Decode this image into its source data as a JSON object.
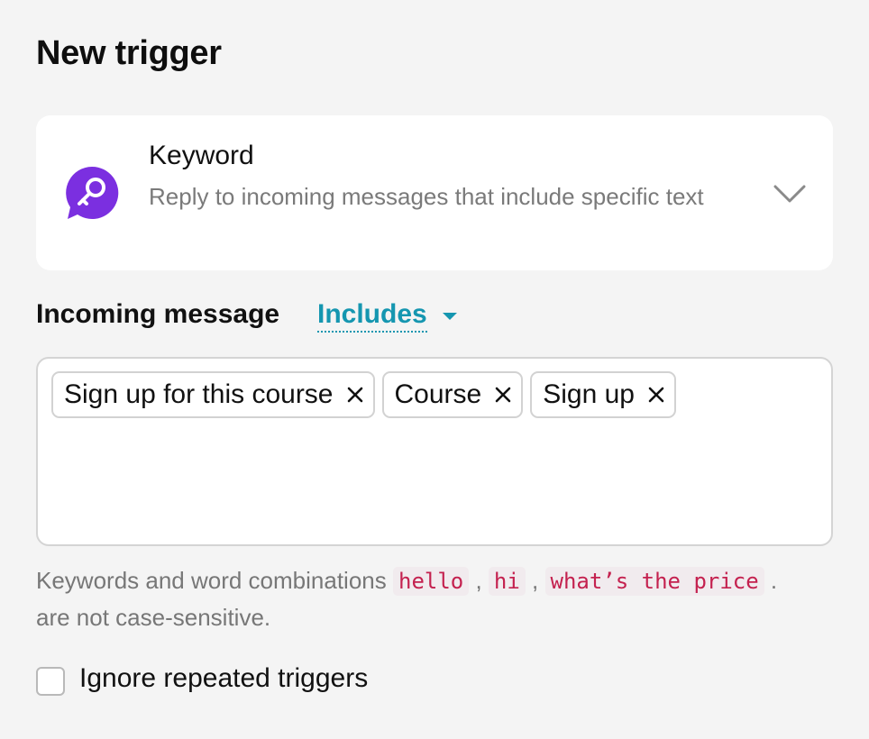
{
  "page": {
    "title": "New trigger"
  },
  "trigger": {
    "name": "Keyword",
    "description": "Reply to incoming messages that include specific text",
    "icon": "keyword-key-chat-icon",
    "icon_color": "#7b2fe0"
  },
  "condition": {
    "label": "Incoming message",
    "operator": "Includes",
    "operator_color": "#1596b0"
  },
  "keywords": [
    {
      "label": "Sign up for this course"
    },
    {
      "label": "Course"
    },
    {
      "label": "Sign up"
    }
  ],
  "hint": {
    "prefix": "Keywords and word combinations",
    "examples": [
      "hello",
      "hi",
      "what’s the price"
    ],
    "suffix": "are not case-sensitive."
  },
  "options": {
    "ignore_repeated": {
      "label": "Ignore repeated triggers",
      "checked": false
    }
  }
}
